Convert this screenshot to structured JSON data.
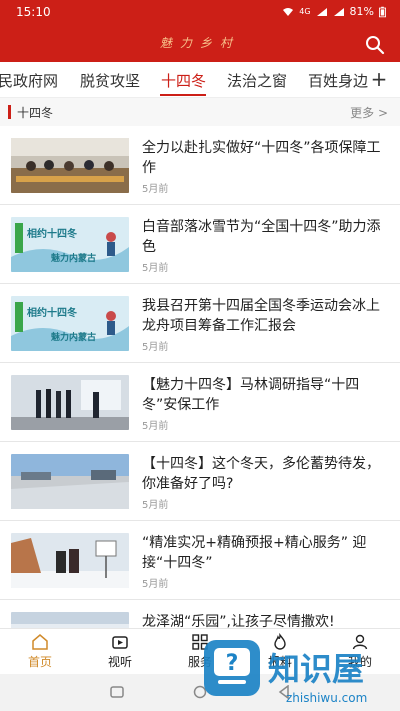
{
  "status": {
    "time": "15:10",
    "battery": "81%",
    "network": "4G"
  },
  "header": {
    "title": "魅力乡村"
  },
  "tabs": [
    {
      "label": "民政府网"
    },
    {
      "label": "脱贫攻坚"
    },
    {
      "label": "十四冬"
    },
    {
      "label": "法治之窗"
    },
    {
      "label": "百姓身边"
    }
  ],
  "tab_add_label": "+",
  "section": {
    "title": "十四冬",
    "more": "更多 >"
  },
  "news": [
    {
      "title": "全力以赴扎实做好“十四冬”各项保障工作",
      "time": "5月前",
      "thumb": "meeting"
    },
    {
      "title": "白音部落冰雪节为“全国十四冬”助力添色",
      "time": "5月前",
      "thumb": "poster"
    },
    {
      "title": "我县召开第十四届全国冬季运动会冰上龙舟项目筹备工作汇报会",
      "time": "5月前",
      "thumb": "poster"
    },
    {
      "title": "【魅力十四冬】马林调研指导“十四冬”安保工作",
      "time": "5月前",
      "thumb": "room"
    },
    {
      "title": "【十四冬】这个冬天，多伦蓄势待发，你准备好了吗?",
      "time": "5月前",
      "thumb": "stadium"
    },
    {
      "title": "“精准实况+精确预报+精心服务” 迎接“十四冬”",
      "time": "5月前",
      "thumb": "snow"
    },
    {
      "title": "龙泽湖“乐园”,让孩子尽情撒欢!",
      "time": "",
      "thumb": "lake"
    }
  ],
  "poster_text": {
    "line1": "相约十四冬",
    "line2": "魅力内蒙古"
  },
  "bottom_nav": [
    {
      "label": "首页",
      "icon": "home-icon"
    },
    {
      "label": "视听",
      "icon": "tv-icon"
    },
    {
      "label": "服务",
      "icon": "grid-icon"
    },
    {
      "label": "报料",
      "icon": "fire-icon"
    },
    {
      "label": "我的",
      "icon": "user-icon"
    }
  ],
  "watermark": {
    "text": "知识屋",
    "sub": "zhishiwu.com"
  },
  "colors": {
    "brand": "#cc1f17",
    "active_nav": "#d08a2a"
  }
}
